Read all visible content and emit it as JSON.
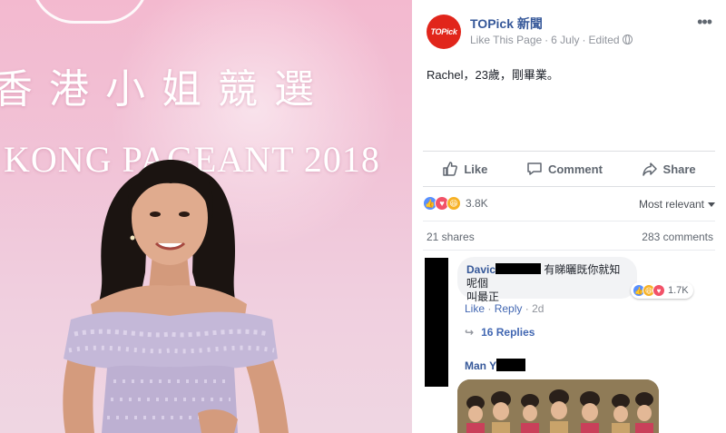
{
  "photo": {
    "backdrop_chinese": "香港小姐競選",
    "backdrop_english": "KONG PAGEANT 2018"
  },
  "post": {
    "page_name": "TOPick 新聞",
    "page_avatar_text": "TOPick",
    "like_page": "Like This Page",
    "date": "6 July",
    "edited": "Edited",
    "text": "Rachel，23歲，剛畢業。",
    "actions": {
      "like": "Like",
      "comment": "Comment",
      "share": "Share"
    },
    "reactions_count": "3.8K",
    "sort_label": "Most relevant",
    "shares": "21 shares",
    "comments_count": "283 comments",
    "comments": [
      {
        "name": "Davic",
        "text_line1": "有睇曬既你就知呢個",
        "text_line2": "叫最正",
        "reactions": "1.7K",
        "like": "Like",
        "reply": "Reply",
        "time": "2d",
        "replies": "16 Replies"
      },
      {
        "name": "Man Y"
      }
    ]
  },
  "colors": {
    "brand_blue": "#365899",
    "topick_red": "#e1251b",
    "like_blue": "#5890ff",
    "love_red": "#f25268",
    "haha_yellow": "#f7b125"
  }
}
